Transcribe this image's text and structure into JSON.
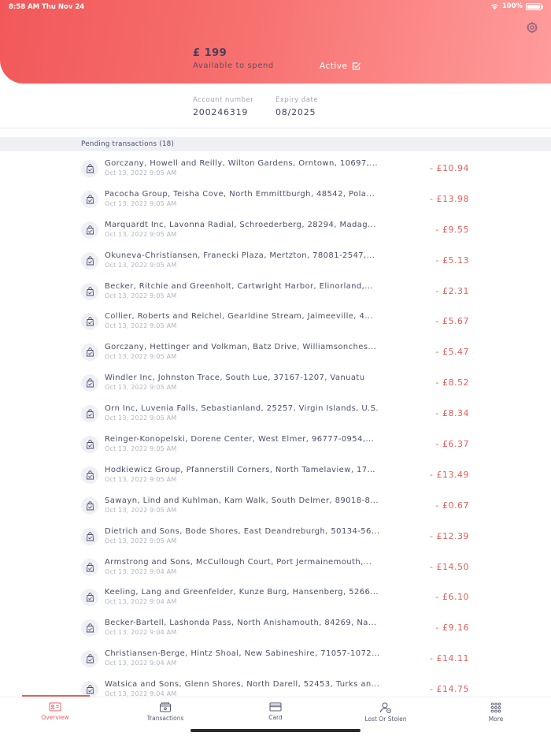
{
  "status_bar": {
    "time": "8:58 AM",
    "date": "Thu Nov 24",
    "battery": "100%"
  },
  "header": {
    "balance": "£ 199",
    "available_label": "Available to spend",
    "card_status": "Active"
  },
  "account": {
    "number_label": "Account number",
    "number": "200246319",
    "expiry_label": "Expiry date",
    "expiry": "08/2025"
  },
  "pending_header": "Pending transactions (18)",
  "transactions": [
    {
      "merchant": "Gorczany, Howell and Reilly, Wilton Gardens, Orntown, 10697,...",
      "date": "Oct 13, 2022 9:05 AM",
      "amount": "- £10.94"
    },
    {
      "merchant": "Pacocha Group, Teisha Cove, North Emmittburgh, 48542, Pola...",
      "date": "Oct 13, 2022 9:05 AM",
      "amount": "- £13.98"
    },
    {
      "merchant": "Marquardt Inc, Lavonna Radial, Schroederberg, 28294, Madag...",
      "date": "Oct 13, 2022 9:05 AM",
      "amount": "- £9.55"
    },
    {
      "merchant": "Okuneva-Christiansen, Franecki Plaza, Mertzton, 78081-2547,...",
      "date": "Oct 13, 2022 9:05 AM",
      "amount": "- £5.13"
    },
    {
      "merchant": "Becker, Ritchie and Greenholt, Cartwright Harbor, Elinorland,...",
      "date": "Oct 13, 2022 9:05 AM",
      "amount": "- £2.31"
    },
    {
      "merchant": "Collier, Roberts and Reichel, Gearldine Stream, Jaimeeville, 4...",
      "date": "Oct 13, 2022 9:05 AM",
      "amount": "- £5.67"
    },
    {
      "merchant": "Gorczany, Hettinger and Volkman, Batz Drive, Williamsonches...",
      "date": "Oct 13, 2022 9:05 AM",
      "amount": "- £5.47"
    },
    {
      "merchant": "Windler Inc, Johnston Trace, South Lue, 37167-1207, Vanuatu",
      "date": "Oct 13, 2022 9:05 AM",
      "amount": "- £8.52"
    },
    {
      "merchant": "Orn Inc, Luvenia Falls, Sebastianland, 25257, Virgin Islands, U.S.",
      "date": "Oct 13, 2022 9:05 AM",
      "amount": "- £8.34"
    },
    {
      "merchant": "Reinger-Konopelski, Dorene Center, West Elmer, 96777-0954,...",
      "date": "Oct 13, 2022 9:05 AM",
      "amount": "- £6.37"
    },
    {
      "merchant": "Hodkiewicz Group, Pfannerstill Corners, North Tamelaview, 179...",
      "date": "Oct 13, 2022 9:05 AM",
      "amount": "- £13.49"
    },
    {
      "merchant": "Sawayn, Lind and Kuhlman, Kam Walk, South Delmer, 89018-8...",
      "date": "Oct 13, 2022 9:05 AM",
      "amount": "- £0.67"
    },
    {
      "merchant": "Dietrich and Sons, Bode Shores, East Deandreburgh, 50134-56...",
      "date": "Oct 13, 2022 9:05 AM",
      "amount": "- £12.39"
    },
    {
      "merchant": "Armstrong and Sons, McCullough Court, Port Jermainemouth,...",
      "date": "Oct 13, 2022 9:04 AM",
      "amount": "- £14.50"
    },
    {
      "merchant": "Keeling, Lang and Greenfelder, Kunze Burg, Hansenberg, 5266...",
      "date": "Oct 13, 2022 9:04 AM",
      "amount": "- £6.10"
    },
    {
      "merchant": "Becker-Bartell, Lashonda Pass, North Anishamouth, 84269, Na...",
      "date": "Oct 13, 2022 9:04 AM",
      "amount": "- £9.16"
    },
    {
      "merchant": "Christiansen-Berge, Hintz Shoal, New Sabineshire, 71057-1072,...",
      "date": "Oct 13, 2022 9:04 AM",
      "amount": "- £14.11"
    },
    {
      "merchant": "Watsica and Sons, Glenn Shores, North Darell, 52453, Turks an...",
      "date": "Oct 13, 2022 9:04 AM",
      "amount": "- £14.75"
    }
  ],
  "tabs": [
    {
      "label": "Overview",
      "icon": "overview-card-icon"
    },
    {
      "label": "Transactions",
      "icon": "wallet-icon"
    },
    {
      "label": "Card",
      "icon": "credit-card-icon"
    },
    {
      "label": "Lost Or Stolen",
      "icon": "user-alert-icon"
    },
    {
      "label": "More",
      "icon": "grid-dots-icon"
    }
  ],
  "colors": {
    "accent": "#e8605d",
    "header_start": "#f2585a",
    "header_end": "#ff9c9c",
    "text": "#3f4560"
  }
}
